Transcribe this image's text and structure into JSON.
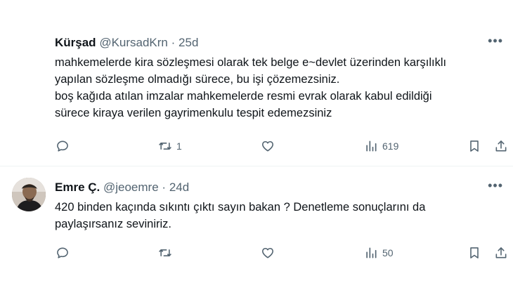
{
  "tweets": [
    {
      "name": "Kürşad",
      "handle": "@KursadKrn",
      "sep": "·",
      "time": "25d",
      "more_icon": "more-dots-icon",
      "lines": [
        "mahkemelerde kira sözleşmesi olarak tek belge e~devlet üzerinden karşılıklı",
        "yapılan sözleşme olmadığı sürece, bu işi çözemezsiniz.",
        "boş kağıda atılan imzalar mahkemelerde resmi evrak olarak kabul edildiği",
        "sürece kiraya verilen gayrimenkulu tespit edemezsiniz"
      ],
      "reply_count": "",
      "retweet_count": "1",
      "like_count": "",
      "view_count": "619"
    },
    {
      "name": "Emre Ç.",
      "handle": "@jeoemre",
      "sep": "·",
      "time": "24d",
      "more_icon": "more-dots-icon",
      "lines": [
        "420 binden kaçında sıkıntı çıktı sayın bakan ? Denetleme sonuçlarını da",
        "paylaşırsanız seviniriz."
      ],
      "reply_count": "",
      "retweet_count": "",
      "like_count": "",
      "view_count": "50"
    }
  ],
  "colors": {
    "text": "#0f1419",
    "secondary": "#536471",
    "divider": "#eff3f4"
  }
}
